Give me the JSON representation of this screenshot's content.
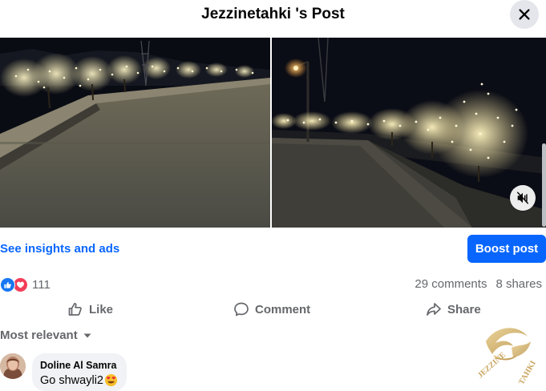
{
  "header": {
    "title": "Jezzinetahki 's Post"
  },
  "icons": {
    "close": "close-icon",
    "mute": "mute-icon",
    "like_reaction": "thumbs-up-icon",
    "love_reaction": "heart-icon",
    "like_action": "thumbs-up-outline-icon",
    "comment_action": "speech-bubble-icon",
    "share_action": "share-arrow-icon",
    "sort": "chevron-down-icon"
  },
  "post": {
    "insights_link": "See insights and ads",
    "boost_button": "Boost post",
    "reaction_count": "111",
    "comments_count": "29 comments",
    "shares_count": "8 shares"
  },
  "actions": {
    "like": "Like",
    "comment": "Comment",
    "share": "Share"
  },
  "comments": {
    "sort_label": "Most relevant",
    "items": [
      {
        "author": "Doline Al Samra",
        "text": "Go shwayli2"
      }
    ]
  },
  "watermark": {
    "text": "JEZZINE TAHKI"
  },
  "colors": {
    "accent": "#0866ff",
    "like": "#1877f2",
    "love": "#f33e58",
    "muted_text": "#65676b"
  }
}
